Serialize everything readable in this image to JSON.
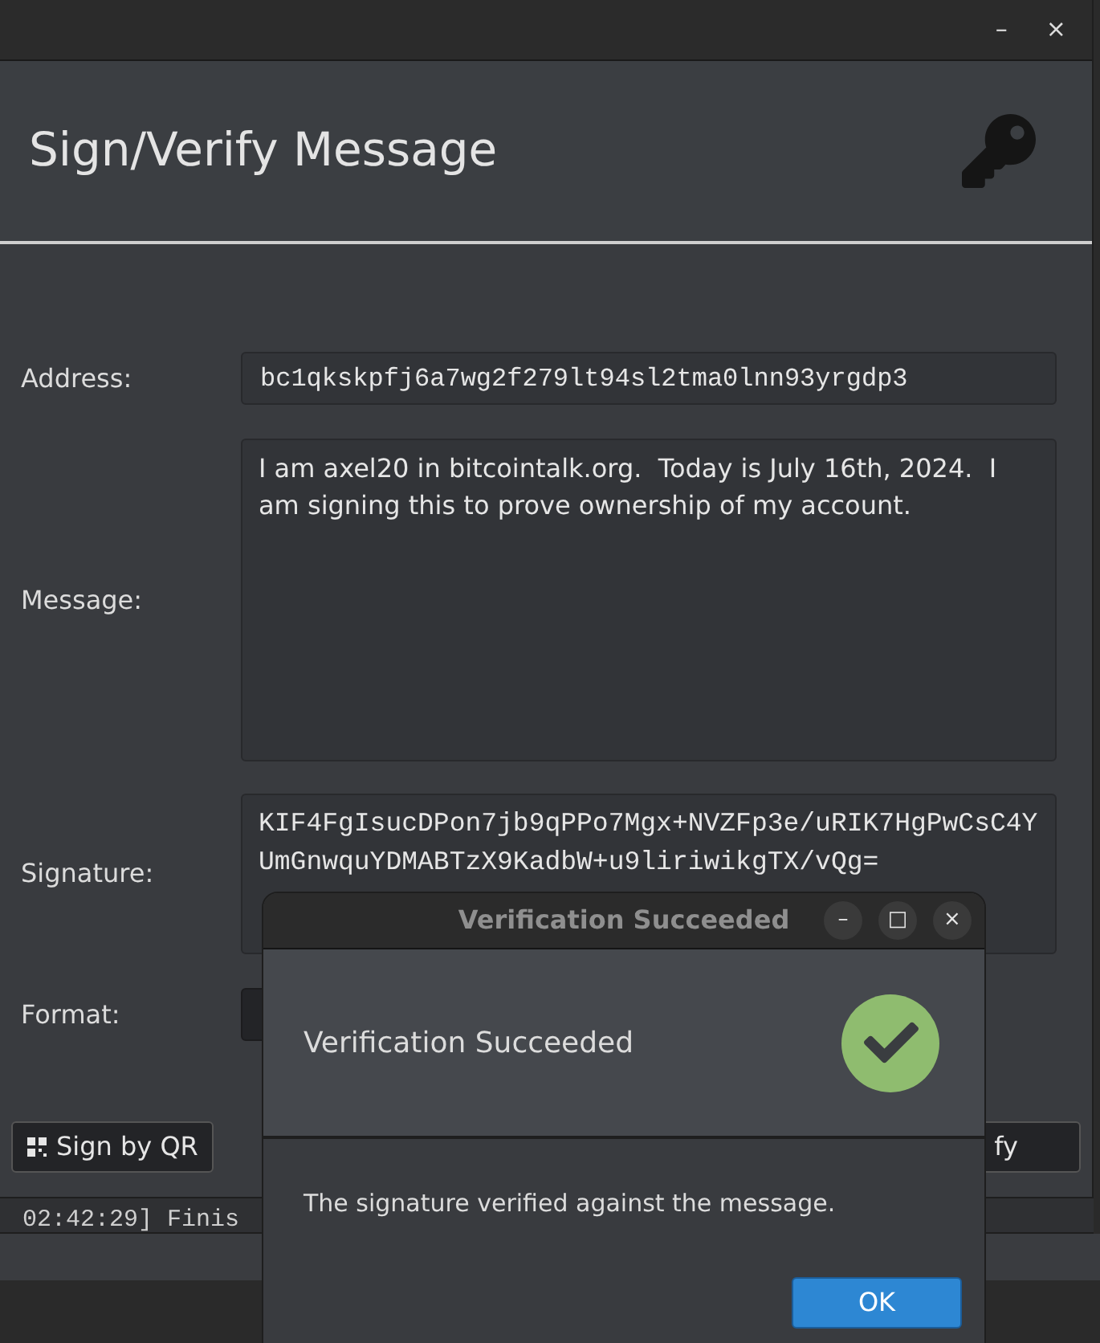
{
  "window": {
    "title": "Sign/Verify Message",
    "controls": [
      "–",
      "×"
    ]
  },
  "fields": [
    {
      "label": "Address:",
      "kind": "line",
      "value": "bc1qkskpfj6a7wg2f279lt94sl2tma0lnn93yrgdp3"
    },
    {
      "label": "Message:",
      "kind": "text",
      "value": "I am axel20 in bitcointalk.org.  Today is July 16th, 2024.  I am signing this to prove ownership of my account."
    },
    {
      "label": "Signature:",
      "kind": "mono",
      "value": "KIF4FgIsucDPon7jb9qPPo7Mgx+NVZFp3e/uRIK7HgPwCsC4YUmGnwquYDMABTzX9KadbW+u9liriwikgTX/vQg="
    },
    {
      "label": "Format:",
      "kind": "combo"
    }
  ],
  "buttons": [
    {
      "label": "Sign by QR"
    },
    {
      "label": "fy"
    }
  ],
  "log_line": "02:42:29] Finis",
  "dialog": {
    "title": "Verification Succeeded",
    "heading": "Verification Succeeded",
    "message": "The signature verified against the message.",
    "ok": "OK",
    "controls": [
      "–",
      "□",
      "×"
    ]
  }
}
